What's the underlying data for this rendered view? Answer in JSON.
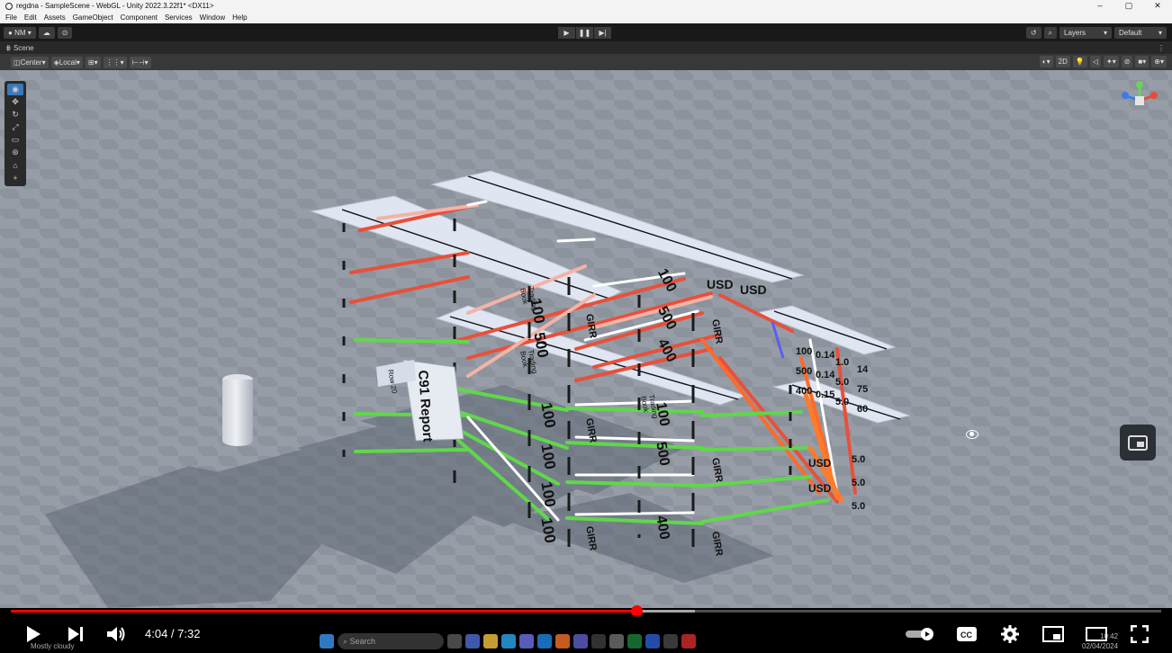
{
  "window": {
    "title": "regdna - SampleScene - WebGL - Unity 2022.3.22f1* <DX11>",
    "controls": {
      "minimize": "–",
      "maximize": "▢",
      "close": "✕"
    }
  },
  "menu": [
    "File",
    "Edit",
    "Assets",
    "GameObject",
    "Component",
    "Services",
    "Window",
    "Help"
  ],
  "toolbar": {
    "account": "NM",
    "layers_label": "Layers",
    "layout_label": "Default"
  },
  "scene_tab": {
    "label": "Scene"
  },
  "scene_toolbar": {
    "pivot": "Center",
    "space": "Local",
    "mode_2d": "2D"
  },
  "scene": {
    "report_label": "C91 Report",
    "row_label": "Row 20",
    "cell_values_100": "100",
    "cell_values_500": "500",
    "cell_values_400": "400",
    "girr_label": "GIRR",
    "trading_book_label": "Trading Book",
    "currency": "USD",
    "sensitivity_column_a": [
      "100",
      "500",
      "400"
    ],
    "sensitivity_column_b": [
      "0.14",
      "0.14",
      "0.15"
    ],
    "sensitivity_column_c": [
      "1.0",
      "5.0",
      "5.0"
    ],
    "sensitivity_column_d": [
      "14",
      "75",
      "60"
    ],
    "bottom_values": [
      "5.0",
      "5.0",
      "5.0"
    ]
  },
  "player": {
    "current_time": "4:04",
    "duration": "7:32",
    "time_display": "4:04 / 7:32",
    "played_fraction": 0.544,
    "loaded_fraction": 0.595
  },
  "taskbar": {
    "search_placeholder": "Search",
    "weather": "Mostly cloudy",
    "clock_time": "10:42",
    "clock_date": "02/04/2024"
  },
  "colors": {
    "link_red": "#e8503a",
    "link_green": "#5fd84a",
    "link_pink": "#f4b3a8",
    "panel": "#dfe6f2",
    "youtube_red": "#ff0000"
  }
}
